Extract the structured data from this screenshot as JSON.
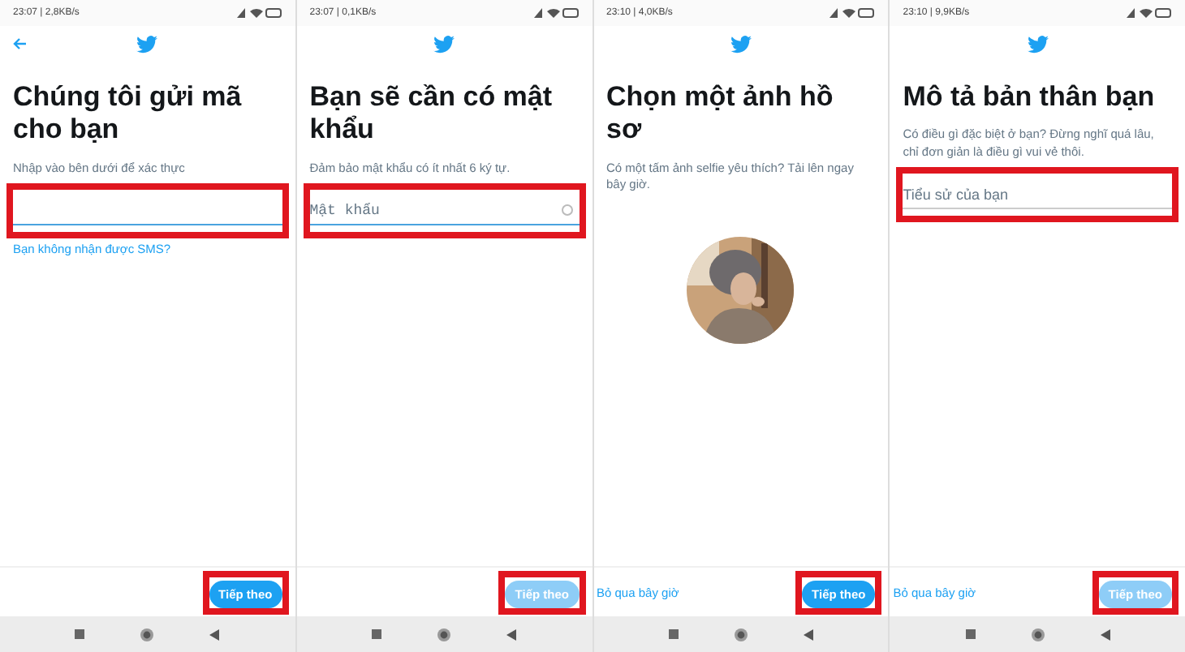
{
  "panels": [
    {
      "status": "23:07 | 2,8KB/s",
      "back_button": true,
      "title": "Chúng tôi gửi mã cho bạn",
      "subtitle": "Nhập vào bên dưới để xác thực",
      "field": {
        "kind": "code",
        "focused": true,
        "highlighted": true
      },
      "link": "Bạn không nhận được SMS?",
      "button": {
        "label": "Tiếp theo",
        "disabled": false,
        "highlighted": true
      }
    },
    {
      "status": "23:07 | 0,1KB/s",
      "title": "Bạn sẽ cần có mật khẩu",
      "subtitle": "Đảm bảo mật khẩu có ít nhất 6 ký tự.",
      "field": {
        "kind": "password",
        "placeholder": "Mật khẩu",
        "focused": true,
        "highlighted": true
      },
      "button": {
        "label": "Tiếp theo",
        "disabled": true,
        "highlighted": true
      }
    },
    {
      "status": "23:10 | 4,0KB/s",
      "title": "Chọn một ảnh hồ sơ",
      "subtitle": "Có một tấm ảnh selfie yêu thích? Tải lên ngay bây giờ.",
      "skip": "Bỏ qua bây giờ",
      "button": {
        "label": "Tiếp theo",
        "disabled": false,
        "highlighted": true
      }
    },
    {
      "status": "23:10 | 9,9KB/s",
      "title": "Mô tả bản thân bạn",
      "subtitle": "Có điều gì đặc biệt ở bạn? Đừng nghĩ quá lâu, chỉ đơn giản là điều gì vui vẻ thôi.",
      "field": {
        "kind": "text",
        "placeholder": "Tiểu sử của bạn",
        "focused": false,
        "highlighted": true
      },
      "skip": "Bỏ qua bây giờ",
      "button": {
        "label": "Tiếp theo",
        "disabled": true,
        "highlighted": true
      }
    }
  ]
}
